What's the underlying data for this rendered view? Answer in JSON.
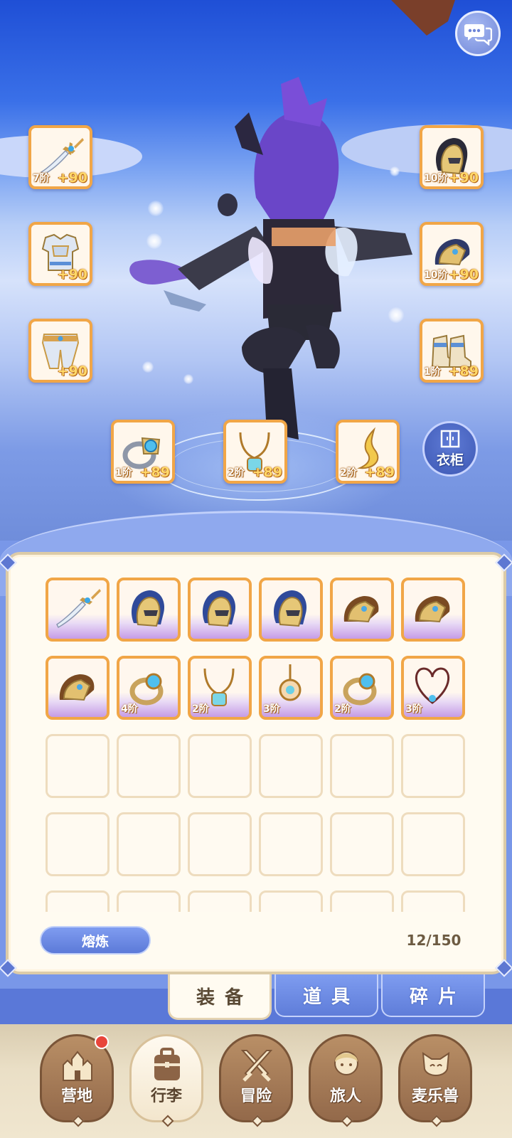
{
  "equipment": {
    "weapon": {
      "tier": "7阶",
      "plus": "+90",
      "icon": "sword-icon"
    },
    "armor_top": {
      "tier": "",
      "plus": "+90",
      "icon": "chest-armor-icon"
    },
    "armor_legs": {
      "tier": "",
      "plus": "+90",
      "icon": "leg-armor-icon"
    },
    "helmet": {
      "tier": "10阶",
      "plus": "+90",
      "icon": "helmet-icon"
    },
    "gauntlet": {
      "tier": "10阶",
      "plus": "+90",
      "icon": "gauntlet-icon"
    },
    "boots": {
      "tier": "1阶",
      "plus": "+89",
      "icon": "boots-icon"
    },
    "ring": {
      "tier": "1阶",
      "plus": "+89",
      "icon": "ring-icon"
    },
    "necklace": {
      "tier": "2阶",
      "plus": "+89",
      "icon": "necklace-icon"
    },
    "charm": {
      "tier": "2阶",
      "plus": "+89",
      "icon": "charm-icon"
    }
  },
  "wardrobe_label": "衣柜",
  "inventory": {
    "items": [
      {
        "icon": "sword-icon",
        "tier": ""
      },
      {
        "icon": "helmet-icon",
        "tier": ""
      },
      {
        "icon": "helmet-icon",
        "tier": ""
      },
      {
        "icon": "helmet-icon",
        "tier": ""
      },
      {
        "icon": "gauntlet-icon",
        "tier": ""
      },
      {
        "icon": "gauntlet-icon",
        "tier": ""
      },
      {
        "icon": "gauntlet-icon",
        "tier": ""
      },
      {
        "icon": "ring-icon",
        "tier": "4阶"
      },
      {
        "icon": "necklace-icon",
        "tier": "2阶"
      },
      {
        "icon": "pendant-icon",
        "tier": "3阶"
      },
      {
        "icon": "ring-icon",
        "tier": "2阶"
      },
      {
        "icon": "heart-necklace-icon",
        "tier": "3阶"
      }
    ],
    "smelt_label": "熔炼",
    "capacity": "12/150"
  },
  "tabs": [
    {
      "label": "装备",
      "active": true
    },
    {
      "label": "道具",
      "active": false
    },
    {
      "label": "碎片",
      "active": false
    }
  ],
  "nav": [
    {
      "label": "营地",
      "icon": "castle-icon",
      "badge": true,
      "active": false
    },
    {
      "label": "行李",
      "icon": "backpack-icon",
      "badge": false,
      "active": true
    },
    {
      "label": "冒险",
      "icon": "crossed-swords-icon",
      "badge": false,
      "active": false
    },
    {
      "label": "旅人",
      "icon": "traveler-icon",
      "badge": false,
      "active": false
    },
    {
      "label": "麦乐兽",
      "icon": "cat-icon",
      "badge": false,
      "active": false
    }
  ],
  "colors": {
    "slot_border": "#f1a647",
    "tab_active": "#fffbf1",
    "tab_inactive": "#6f8de4",
    "nav_button": "#93694a",
    "badge": "#e8453b"
  }
}
